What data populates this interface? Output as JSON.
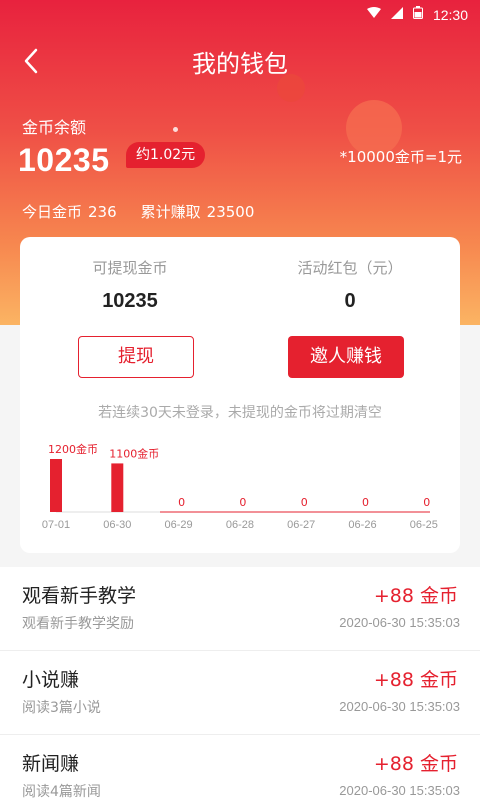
{
  "status_bar": {
    "time": "12:30"
  },
  "nav": {
    "title": "我的钱包"
  },
  "balance": {
    "label": "金币余额",
    "value": "10235",
    "approx": "约1.02元",
    "rate": "*10000金币=1元",
    "today_label": "今日金币",
    "today_value": "236",
    "total_label": "累计赚取",
    "total_value": "23500"
  },
  "card": {
    "withdrawable_label": "可提现金币",
    "withdrawable_value": "10235",
    "redpacket_label": "活动红包（元）",
    "redpacket_value": "0",
    "withdraw_button": "提现",
    "invite_button": "邀人赚钱",
    "notice": "若连续30天未登录，未提现的金币将过期清空"
  },
  "chart_data": {
    "type": "bar",
    "categories": [
      "07-01",
      "06-30",
      "06-29",
      "06-28",
      "06-27",
      "06-26",
      "06-25"
    ],
    "values": [
      1200,
      1100,
      0,
      0,
      0,
      0,
      0
    ],
    "value_labels": [
      "1200金币",
      "1100金币",
      "0",
      "0",
      "0",
      "0",
      "0"
    ],
    "ylim": [
      0,
      1200
    ],
    "bar_color": "#e5212f",
    "label_color": "#e5212f"
  },
  "records": [
    {
      "title": "观看新手教学",
      "subtitle": "观看新手教学奖励",
      "reward": "+88 金币",
      "time": "2020-06-30 15:35:03"
    },
    {
      "title": "小说赚",
      "subtitle": "阅读3篇小说",
      "reward": "+88 金币",
      "time": "2020-06-30 15:35:03"
    },
    {
      "title": "新闻赚",
      "subtitle": "阅读4篇新闻",
      "reward": "+88 金币",
      "time": "2020-06-30 15:35:03"
    }
  ],
  "colors": {
    "accent": "#e5212f",
    "gradient_top": "#e8223e",
    "gradient_bottom": "#fbb463"
  }
}
